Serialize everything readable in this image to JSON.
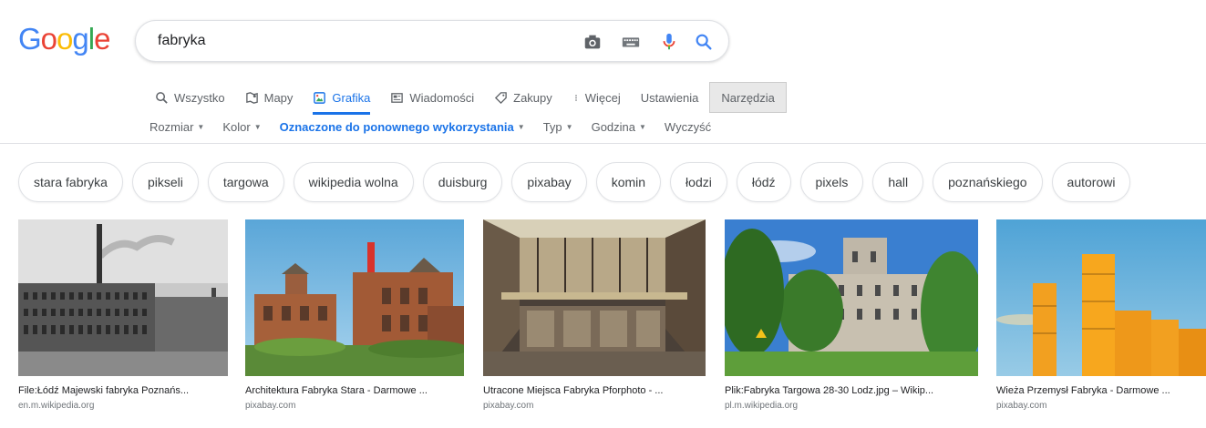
{
  "logo": {
    "text": "Google",
    "letters": [
      "G",
      "o",
      "o",
      "g",
      "l",
      "e"
    ],
    "colors": [
      "#4285F4",
      "#EA4335",
      "#FBBC05",
      "#4285F4",
      "#34A853",
      "#EA4335"
    ]
  },
  "search": {
    "query": "fabryka",
    "icons": [
      "camera-icon",
      "keyboard-icon",
      "microphone-icon",
      "search-icon"
    ]
  },
  "nav": {
    "items": [
      {
        "label": "Wszystko",
        "icon": "search-icon"
      },
      {
        "label": "Mapy",
        "icon": "map-icon"
      },
      {
        "label": "Grafika",
        "icon": "image-icon",
        "active": true
      },
      {
        "label": "Wiadomości",
        "icon": "news-icon"
      },
      {
        "label": "Zakupy",
        "icon": "tag-icon"
      },
      {
        "label": "Więcej",
        "icon": "more-icon"
      },
      {
        "label": "Ustawienia"
      }
    ],
    "tools": "Narzędzia"
  },
  "filters": [
    {
      "label": "Rozmiar"
    },
    {
      "label": "Kolor"
    },
    {
      "label": "Oznaczone do ponownego wykorzystania",
      "selected": true
    },
    {
      "label": "Typ"
    },
    {
      "label": "Godzina"
    },
    {
      "label": "Wyczyść"
    }
  ],
  "chips": [
    "stara fabryka",
    "pikseli",
    "targowa",
    "wikipedia wolna",
    "duisburg",
    "pixabay",
    "komin",
    "łodzi",
    "łódź",
    "pixels",
    "hall",
    "poznańskiego",
    "autorowi"
  ],
  "results": [
    {
      "caption": "File:Łódź Majewski fabryka Poznańs...",
      "source": "en.m.wikipedia.org"
    },
    {
      "caption": "Architektura Fabryka Stara - Darmowe ...",
      "source": "pixabay.com"
    },
    {
      "caption": "Utracone Miejsca Fabryka Pforphoto - ...",
      "source": "pixabay.com"
    },
    {
      "caption": "Plik:Fabryka Targowa 28-30 Lodz.jpg – Wikip...",
      "source": "pl.m.wikipedia.org"
    },
    {
      "caption": "Wieża Przemysł Fabryka - Darmowe ...",
      "source": "pixabay.com"
    }
  ],
  "colors": {
    "accent": "#1a73e8",
    "text_secondary": "#5f6368",
    "border": "#dfe1e5"
  }
}
